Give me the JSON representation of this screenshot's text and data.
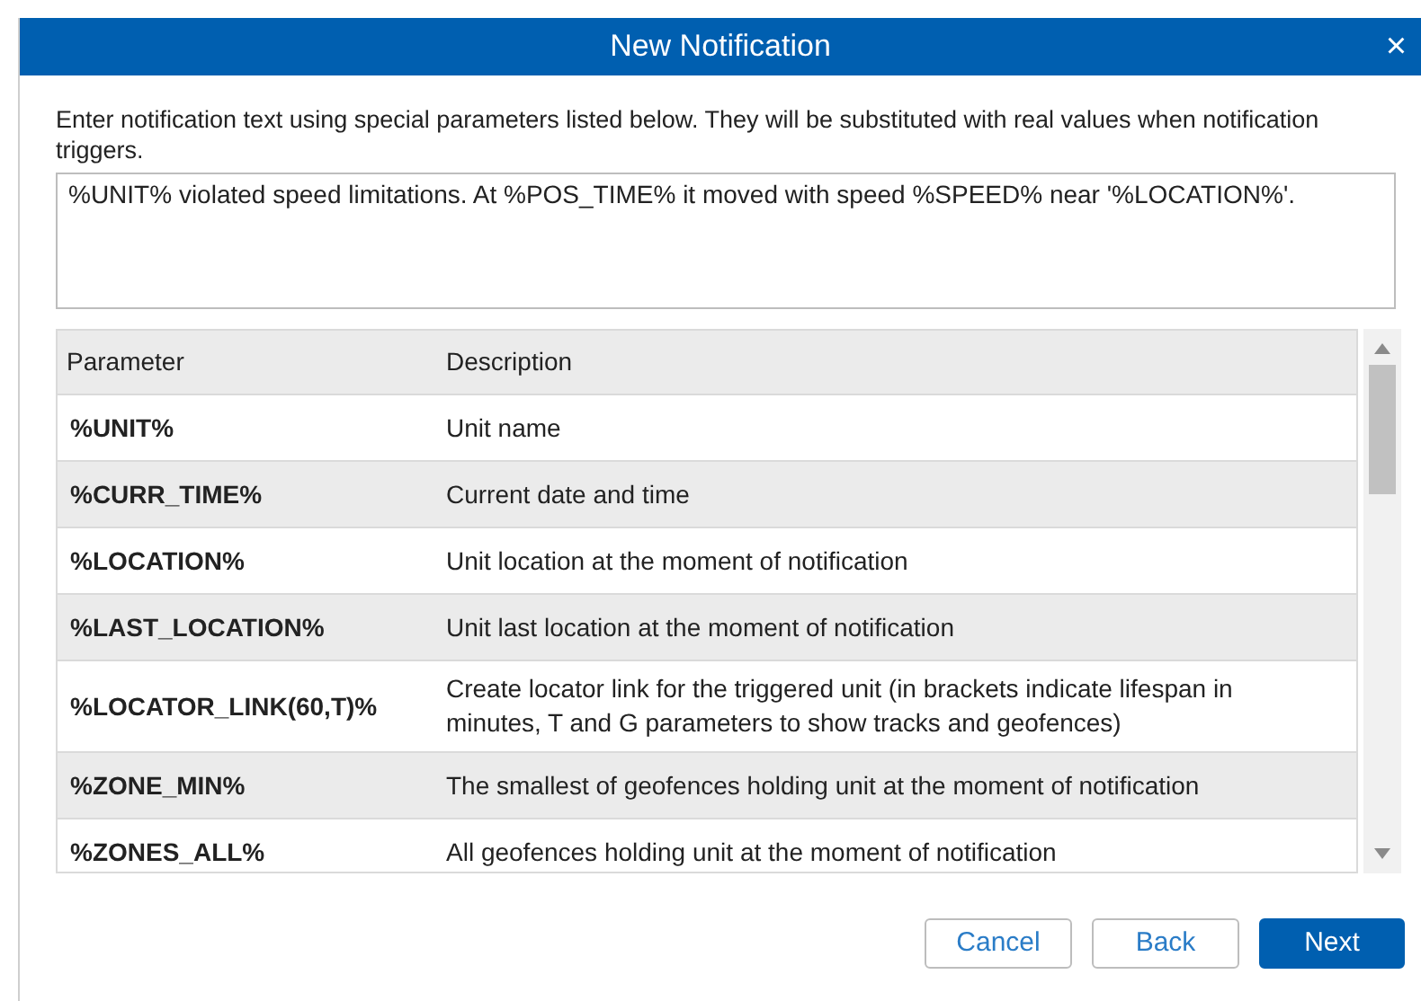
{
  "dialog": {
    "title": "New Notification",
    "close": "×"
  },
  "instructions": "Enter notification text using special parameters listed below. They will be substituted with real values when notification triggers.",
  "message": {
    "value": "%UNIT% violated speed limitations. At %POS_TIME% it moved with speed %SPEED% near '%LOCATION%'."
  },
  "table": {
    "columns": [
      "Parameter",
      "Description"
    ],
    "rows": [
      {
        "parameter": "%UNIT%",
        "description": "Unit name"
      },
      {
        "parameter": "%CURR_TIME%",
        "description": "Current date and time"
      },
      {
        "parameter": "%LOCATION%",
        "description": "Unit location at the moment of notification"
      },
      {
        "parameter": "%LAST_LOCATION%",
        "description": "Unit last location at the moment of notification"
      },
      {
        "parameter": "%LOCATOR_LINK(60,T)%",
        "description": "Create locator link for the triggered unit (in brackets indicate lifespan in minutes, T and G parameters to show tracks and geofences)"
      },
      {
        "parameter": "%ZONE_MIN%",
        "description": "The smallest of geofences holding unit at the moment of notification"
      },
      {
        "parameter": "%ZONES_ALL%",
        "description": "All geofences holding unit at the moment of notification"
      }
    ]
  },
  "buttons": [
    {
      "label": "Cancel",
      "kind": "secondary"
    },
    {
      "label": "Back",
      "kind": "secondary"
    },
    {
      "label": "Next",
      "kind": "primary"
    }
  ]
}
